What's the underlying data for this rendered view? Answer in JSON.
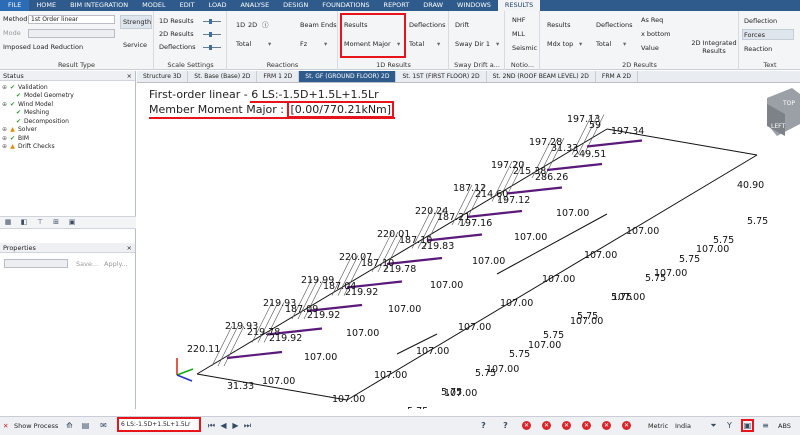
{
  "menu": [
    "FILE",
    "HOME",
    "BIM INTEGRATION",
    "MODEL",
    "EDIT",
    "LOAD",
    "ANALYSE",
    "DESIGN",
    "FOUNDATIONS",
    "REPORT",
    "DRAW",
    "WINDOWS",
    "RESULTS"
  ],
  "ribbon": {
    "result_type": {
      "method_label": "Method",
      "method_value": "1st Order linear",
      "mode_label": "Mode",
      "imposed": "Imposed Load Reduction",
      "strength": "Strength",
      "service": "Service",
      "group": "Result Type"
    },
    "scale": {
      "r1": "1D Results",
      "r2": "2D Results",
      "r3": "Deflections",
      "group": "Scale Settings"
    },
    "reactions": {
      "d1": "1D",
      "d2": "2D",
      "total": "Total",
      "beam_ends": "Beam Ends",
      "fz": "Fz",
      "group": "Reactions"
    },
    "oned": {
      "results": "Results",
      "moment": "Moment Major",
      "deflections": "Deflections",
      "total": "Total",
      "drift": "Drift",
      "sway": "Sway Dir 1",
      "group": "1D Results",
      "drift_group": "Sway Drift a..."
    },
    "notio": {
      "nhf": "NHF",
      "mll": "MLL",
      "seismic": "Seismic",
      "group": "Notio..."
    },
    "twod": {
      "results": "Results",
      "mdx": "Mdx top",
      "deflections": "Deflections",
      "total": "Total",
      "asreq": "As Req",
      "xbottom": "x bottom",
      "value": "Value",
      "integrated": "2D Integrated Results",
      "group": "2D Results"
    },
    "text": {
      "deflection": "Deflection",
      "forces": "Forces",
      "reaction": "Reaction",
      "group": "Text"
    }
  },
  "status_panel": {
    "title": "Status",
    "items": [
      {
        "label": "Validation",
        "state": "ok"
      },
      {
        "label": "Model Geometry",
        "state": "ok"
      },
      {
        "label": "Wind Model",
        "state": "ok"
      },
      {
        "label": "Meshing",
        "state": "ok"
      },
      {
        "label": "Decomposition",
        "state": "ok"
      },
      {
        "label": "Solver",
        "state": "warn"
      },
      {
        "label": "BIM",
        "state": "ok"
      },
      {
        "label": "Drift Checks",
        "state": "warn"
      }
    ]
  },
  "properties_panel": {
    "title": "Properties",
    "save": "Save...",
    "apply": "Apply..."
  },
  "tabs": [
    "Structure 3D",
    "St. Base (Base) 2D",
    "FRM 1 2D",
    "St. GF (GROUND FLOOR) 2D",
    "St. 1ST (FIRST FLOOR) 2D",
    "St. 2ND (ROOF BEAM LEVEL) 2D",
    "FRM A 2D"
  ],
  "active_tab": 3,
  "viewport": {
    "line1_prefix": "First-order linear - ",
    "line1_combo": "6 LS:-1.5D+1.5L+1.5Lr",
    "line2_prefix": "Member Moment Major : ",
    "line2_range": "[0.00/770.21kNm]",
    "cube_top": "TOP",
    "cube_left": "LEFT",
    "labels": [
      "197.13",
      "59",
      "197.34",
      "197.28",
      "31.33",
      "249.51",
      "197.20",
      "215.38",
      "286.26",
      "187.12",
      "214.60",
      "197.12",
      "220.24",
      "187.21",
      "197.16",
      "220.01",
      "187.10",
      "219.83",
      "220.07",
      "187.10",
      "219.78",
      "219.99",
      "187.04",
      "219.92",
      "219.93",
      "187.09",
      "219.92",
      "219.93",
      "219.78",
      "219.92",
      "220.11",
      "107.00",
      "107.00",
      "107.00",
      "107.00",
      "107.00",
      "107.00",
      "107.00",
      "107.00",
      "107.00",
      "107.00",
      "107.00",
      "107.00",
      "107.00",
      "107.00",
      "107.00",
      "107.00",
      "107.00",
      "107.00",
      "107.00",
      "107.00",
      "107.00",
      "107.00",
      "107.00",
      "107.00",
      "40.90",
      "5.75",
      "5.75",
      "5.75",
      "5.75",
      "5.75",
      "5.75",
      "5.75",
      "5.75",
      "5.75",
      "5.75",
      "5.75",
      "31.33"
    ]
  },
  "statusbar": {
    "show_process": "Show Process",
    "combo": "6 LS:-1.5D+1.5L+1.5Lr",
    "metric": "Metric",
    "region": "India",
    "abs": "ABS"
  }
}
